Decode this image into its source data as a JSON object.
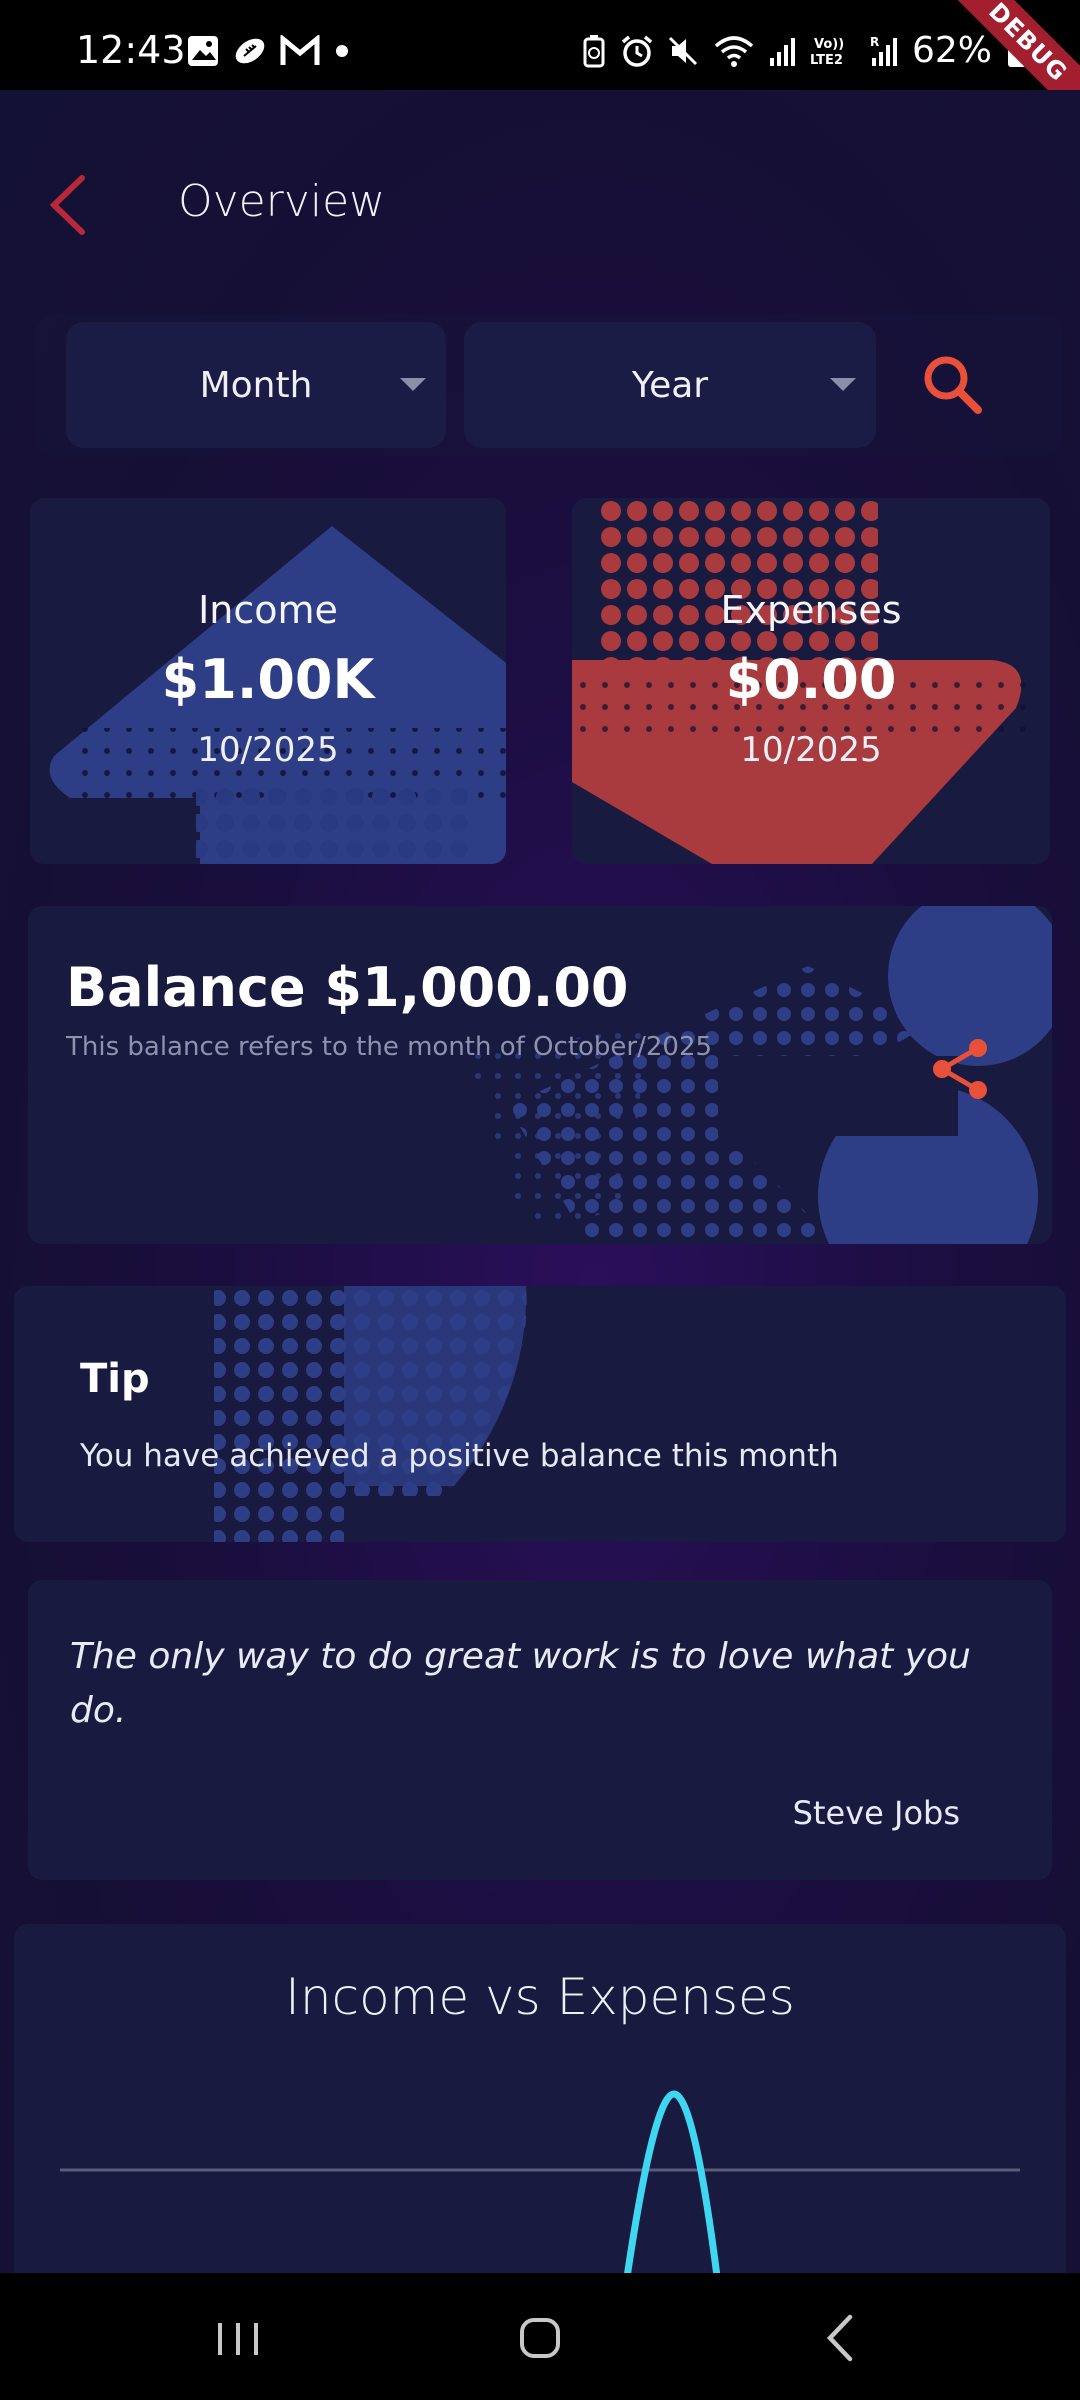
{
  "status_bar": {
    "time": "12:43",
    "battery_text": "62%",
    "debug_label": "DEBUG",
    "left_icons": [
      "image-icon",
      "football-icon",
      "gmail-icon",
      "dot-icon"
    ],
    "right_icons": [
      "battery-saver-icon",
      "alarm-icon",
      "mute-icon",
      "wifi-icon",
      "signal-icon",
      "volte-icon",
      "signal-icon-2",
      "battery-icon"
    ],
    "volte_label": "Vo))\nLTE2"
  },
  "header": {
    "title": "Overview"
  },
  "filters": {
    "month_label": "Month",
    "year_label": "Year"
  },
  "income": {
    "label": "Income",
    "amount": "$1.00K",
    "date": "10/2025"
  },
  "expenses": {
    "label": "Expenses",
    "amount": "$0.00",
    "date": "10/2025"
  },
  "balance": {
    "title": "Balance $1,000.00",
    "subtitle": "This balance refers to the month of October/2025"
  },
  "tip": {
    "title": "Tip",
    "text": "You have achieved a positive balance this month"
  },
  "quote": {
    "text": "The only way to do great work is to love what you do.",
    "author": "Steve Jobs"
  },
  "chart": {
    "title": "Income vs Expenses"
  },
  "colors": {
    "accent_red": "#e8503a",
    "back_red": "#b8283a",
    "income_blue": "#2e3e86",
    "expense_red": "#a93a3e",
    "chart_line": "#3fd6f2"
  }
}
